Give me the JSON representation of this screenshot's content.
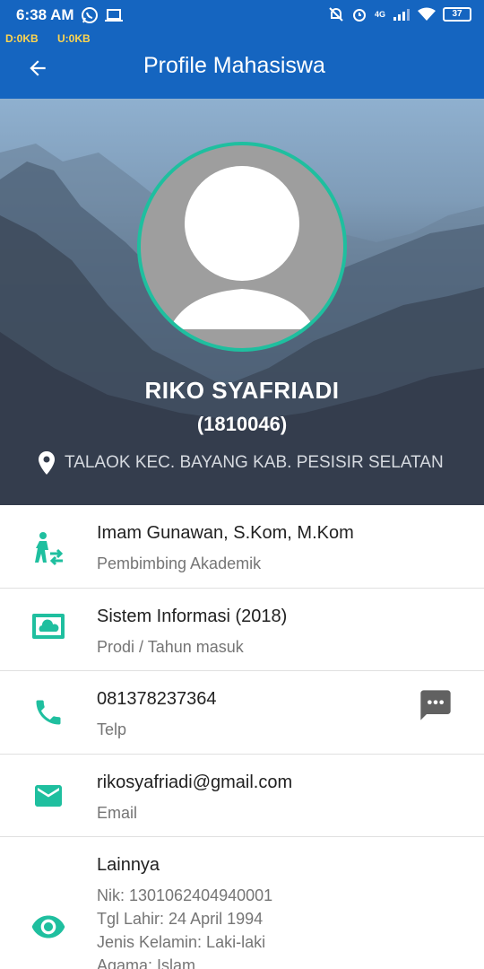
{
  "status_bar": {
    "time": "6:38 AM",
    "battery": "37",
    "network_label": "4G",
    "download": "D:0KB",
    "upload": "U:0KB",
    "icons": [
      "whatsapp-icon",
      "laptop-icon",
      "mute-icon",
      "alarm-icon",
      "signal-icon",
      "wifi-icon",
      "battery-icon"
    ]
  },
  "app_bar": {
    "title": "Profile Mahasiswa",
    "back_icon": "arrow-back-icon"
  },
  "profile": {
    "name": "RIKO SYAFRIADI",
    "nim": "(1810046)",
    "address": "TALAOK KEC. BAYANG KAB. PESISIR SELATAN"
  },
  "items": [
    {
      "icon": "advisor-icon",
      "title": "Imam Gunawan, S.Kom, M.Kom",
      "subtitle": "Pembimbing Akademik"
    },
    {
      "icon": "program-icon",
      "title": "Sistem Informasi (2018)",
      "subtitle": "Prodi / Tahun masuk"
    },
    {
      "icon": "phone-icon",
      "title": "081378237364",
      "subtitle": "Telp",
      "action_icon": "chat-icon"
    },
    {
      "icon": "email-icon",
      "title": "rikosyafriadi@gmail.com",
      "subtitle": "Email"
    },
    {
      "icon": "eye-icon",
      "title": "Lainnya",
      "details": [
        "Nik: 1301062404940001",
        "Tgl Lahir: 24 April 1994",
        "Jenis Kelamin: Laki-laki",
        "Agama: Islam"
      ]
    }
  ],
  "colors": {
    "primary": "#1565c0",
    "accent": "#1fbf9f",
    "text_primary": "#212121",
    "text_secondary": "#757575"
  }
}
